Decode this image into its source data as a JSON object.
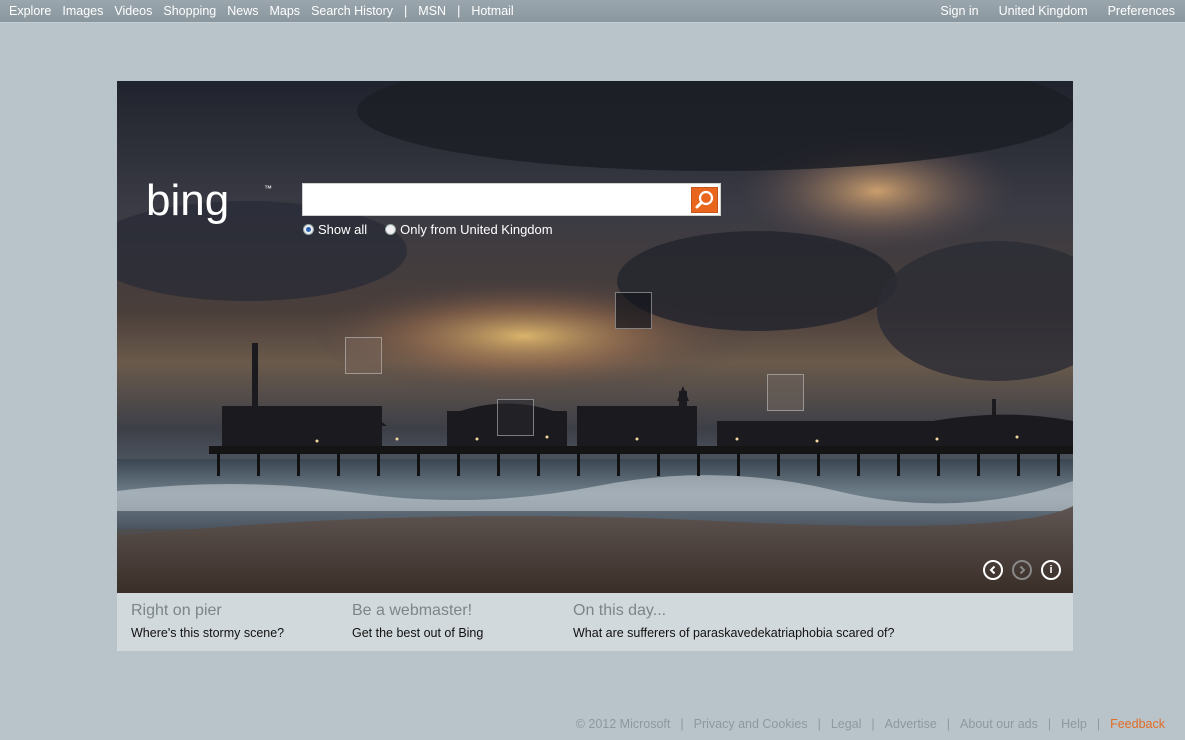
{
  "topnav": {
    "left": [
      "Explore",
      "Images",
      "Videos",
      "Shopping",
      "News",
      "Maps",
      "Search History",
      "MSN",
      "Hotmail"
    ],
    "right": [
      "Sign in",
      "United Kingdom",
      "Preferences"
    ]
  },
  "logo": {
    "text": "bing",
    "mark": "™"
  },
  "search": {
    "value": "",
    "placeholder": "",
    "button_icon": "search-icon",
    "options": [
      "Show all",
      "Only from United Kingdom"
    ],
    "selected": "Show all"
  },
  "image_controls": {
    "prev_icon": "chevron-left-icon",
    "next_icon": "chevron-right-icon",
    "info_icon": "info-icon",
    "info_glyph": "i"
  },
  "info_strip": [
    {
      "head": "Right on pier",
      "link": "Where's this stormy scene?"
    },
    {
      "head": "Be a webmaster!",
      "link": "Get the best out of Bing"
    },
    {
      "head": "On this day...",
      "link": "What are sufferers of paraskavedekatriaphobia scared of?"
    }
  ],
  "footer": {
    "copyright": "© 2012 Microsoft",
    "links": [
      "Privacy and Cookies",
      "Legal",
      "Advertise",
      "About our ads",
      "Help"
    ],
    "feedback": "Feedback"
  },
  "colors": {
    "accent": "#e8661e",
    "feedback": "#e26b25",
    "page_bg": "#b9c4ca"
  }
}
